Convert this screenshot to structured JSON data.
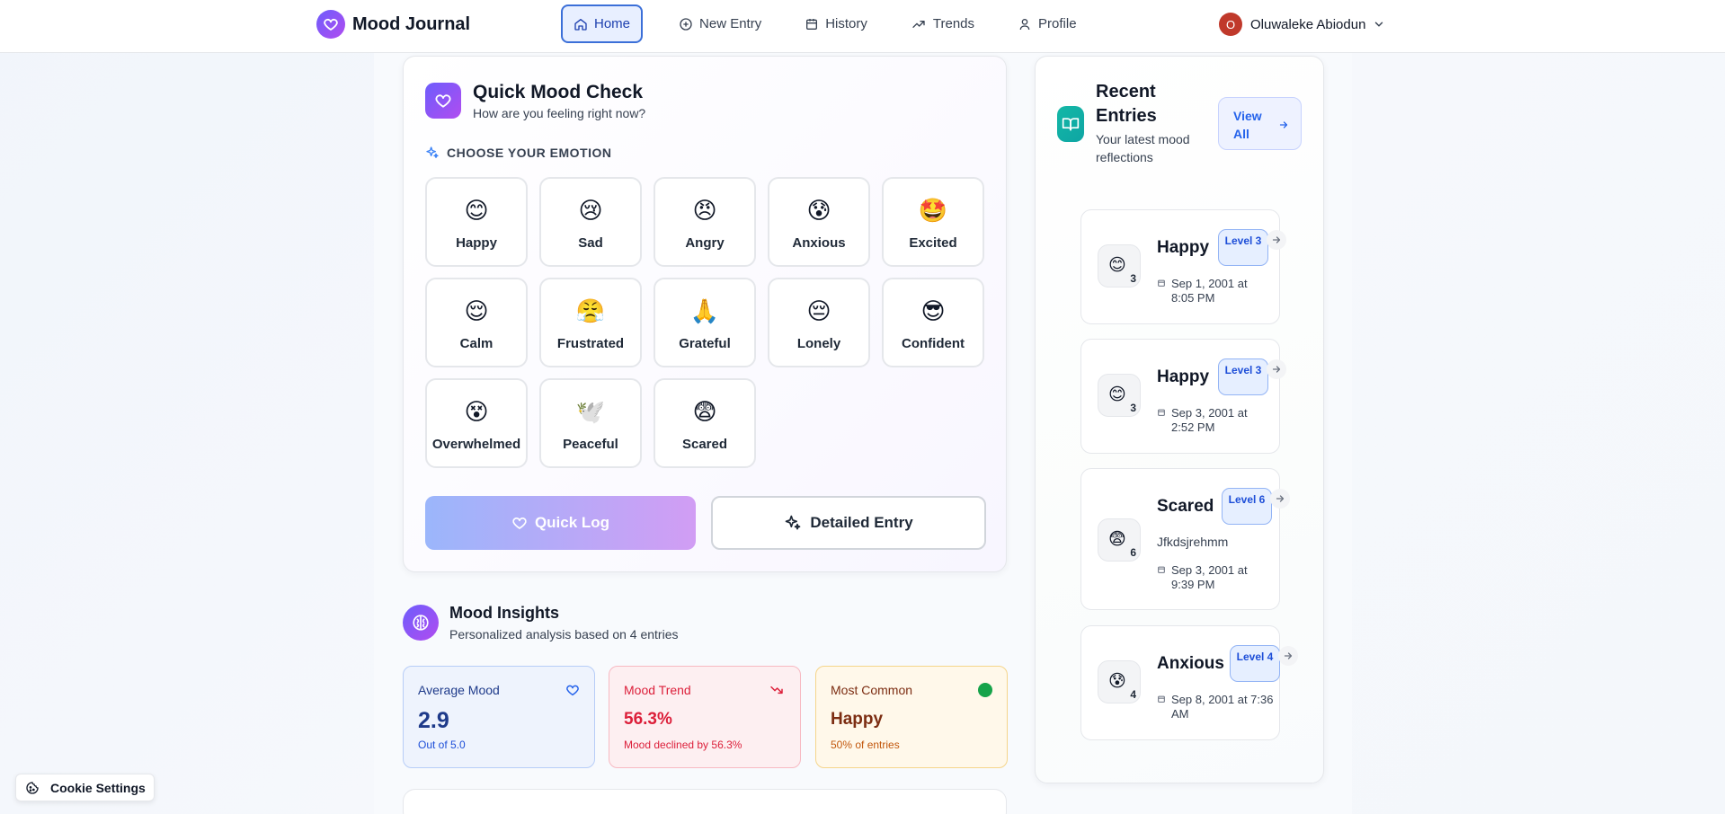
{
  "app": {
    "name": "Mood Journal"
  },
  "nav": {
    "items": [
      {
        "label": "Home",
        "icon": "home-icon",
        "active": true
      },
      {
        "label": "New Entry",
        "icon": "plus-circle-icon"
      },
      {
        "label": "History",
        "icon": "calendar-icon"
      },
      {
        "label": "Trends",
        "icon": "trend-up-icon"
      },
      {
        "label": "Profile",
        "icon": "user-icon"
      }
    ]
  },
  "user": {
    "initial": "O",
    "name": "Oluwaleke Abiodun"
  },
  "quick_check": {
    "title": "Quick Mood Check",
    "subtitle": "How are you feeling right now?",
    "choose_label": "CHOOSE YOUR EMOTION",
    "emotions": [
      {
        "emoji": "😊",
        "label": "Happy"
      },
      {
        "emoji": "😢",
        "label": "Sad"
      },
      {
        "emoji": "😠",
        "label": "Angry"
      },
      {
        "emoji": "😰",
        "label": "Anxious"
      },
      {
        "emoji": "🤩",
        "label": "Excited"
      },
      {
        "emoji": "😌",
        "label": "Calm"
      },
      {
        "emoji": "😤",
        "label": "Frustrated"
      },
      {
        "emoji": "🙏",
        "label": "Grateful"
      },
      {
        "emoji": "😔",
        "label": "Lonely"
      },
      {
        "emoji": "😎",
        "label": "Confident"
      },
      {
        "emoji": "😵",
        "label": "Overwhelmed"
      },
      {
        "emoji": "🕊️",
        "label": "Peaceful"
      },
      {
        "emoji": "😨",
        "label": "Scared"
      }
    ],
    "quick_log_label": "Quick Log",
    "detailed_label": "Detailed Entry"
  },
  "insights": {
    "title": "Mood Insights",
    "subtitle": "Personalized analysis based on 4 entries",
    "average": {
      "label": "Average Mood",
      "value": "2.9",
      "note": "Out of 5.0"
    },
    "trend": {
      "label": "Mood Trend",
      "value": "56.3%",
      "note": "Mood declined by 56.3%"
    },
    "common": {
      "label": "Most Common",
      "value": "Happy",
      "note": "50% of entries"
    }
  },
  "recent": {
    "title": "Recent Entries",
    "subtitle": "Your latest mood reflections",
    "view_all": "View All",
    "entries": [
      {
        "emoji": "😊",
        "level_num": "3",
        "mood": "Happy",
        "level": "Level 3",
        "note": "",
        "date": "Sep 1, 2001 at 8:05 PM"
      },
      {
        "emoji": "😊",
        "level_num": "3",
        "mood": "Happy",
        "level": "Level 3",
        "note": "",
        "date": "Sep 3, 2001 at 2:52 PM"
      },
      {
        "emoji": "😨",
        "level_num": "6",
        "mood": "Scared",
        "level": "Level 6",
        "note": "Jfkdsjrehmm",
        "date": "Sep 3, 2001 at 9:39 PM"
      },
      {
        "emoji": "😰",
        "level_num": "4",
        "mood": "Anxious",
        "level": "Level 4",
        "note": "",
        "date": "Sep 8, 2001 at 7:36 AM"
      }
    ]
  },
  "cookie": {
    "label": "Cookie Settings"
  },
  "colors": {
    "brand": "#7c5cf5",
    "active_nav": "#3b6fd8",
    "teal": "#14b8a6"
  }
}
